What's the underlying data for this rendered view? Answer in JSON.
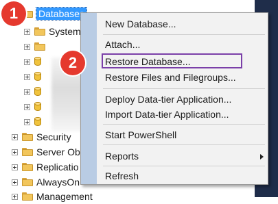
{
  "tree": {
    "selected_node": "Databases",
    "children": [
      {
        "label": "System"
      },
      {
        "label": ""
      },
      {
        "label": ""
      },
      {
        "label": ""
      },
      {
        "label": ""
      },
      {
        "label": ""
      },
      {
        "label": ""
      }
    ],
    "siblings": [
      {
        "label": "Security"
      },
      {
        "label": "Server Ob"
      },
      {
        "label": "Replicatio"
      },
      {
        "label": "AlwaysOn"
      },
      {
        "label": "Management"
      }
    ]
  },
  "badges": {
    "step1": "1",
    "step2": "2"
  },
  "context_menu": {
    "items": [
      {
        "label": "New Database..."
      },
      {
        "label": "Attach..."
      },
      {
        "label": "Restore Database..."
      },
      {
        "label": "Restore Files and Filegroups..."
      },
      {
        "label": "Deploy Data-tier Application..."
      },
      {
        "label": "Import Data-tier Application..."
      },
      {
        "label": "Start PowerShell"
      },
      {
        "label": "Reports"
      },
      {
        "label": "Refresh"
      }
    ],
    "highlighted_item": "Restore Database...",
    "highlight_color": "#7a3fa8",
    "gutter_color": "#b9cce4"
  },
  "colors": {
    "selection": "#3399ff",
    "badge": "#e5392e",
    "right_panel": "#1f2d4a"
  }
}
